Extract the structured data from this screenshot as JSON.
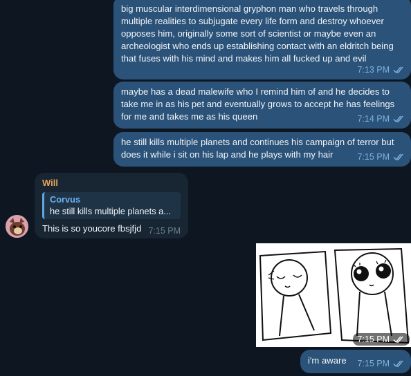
{
  "messages_out": [
    {
      "lines": [
        "big muscular interdimensional gryphon man who travels through",
        "multiple realities to subjugate every life form and destroy whoever",
        "opposes him, originally some sort of scientist or maybe even an",
        "archeologist who ends up establishing contact with an eldritch being",
        "that fuses with his mind and makes him all fucked up and evil"
      ],
      "time": "7:13 PM"
    },
    {
      "lines": [
        "maybe has a dead malewife who I remind him of and he decides to",
        "take me in as his pet and eventually grows to accept he has feelings",
        "for me and takes me as his queen"
      ],
      "time": "7:14 PM"
    },
    {
      "lines": [
        "he still kills multiple planets and continues his campaign of terror but",
        "does it while i sit on his lap and he plays with my hair"
      ],
      "time": "7:15 PM"
    }
  ],
  "message_in": {
    "sender": "Will",
    "reply": {
      "name": "Corvus",
      "text": "he still kills multiple planets a..."
    },
    "text": "This is so youcore fbsjfjd",
    "time": "7:15 PM"
  },
  "image_message": {
    "time": "7:15 PM"
  },
  "last_message": {
    "text": "i'm aware",
    "time": "7:15 PM"
  },
  "colors": {
    "background": "#0e1621",
    "outgoing_bubble": "#2b5278",
    "incoming_bubble": "#182533",
    "sender_name": "#e9a35a",
    "reply_name": "#6ab2f2",
    "timestamp_out": "#7eb1e0"
  },
  "icons": {
    "read_receipt": "double-check-icon"
  }
}
